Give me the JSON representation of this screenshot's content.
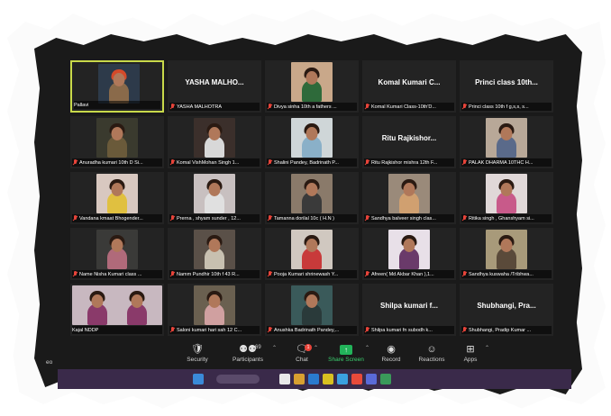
{
  "participants": [
    {
      "caption": "Pallavi",
      "display_name": "",
      "video": true,
      "active": true,
      "muted": false,
      "bg": "#2d3a4a",
      "top": "#8a6a4a",
      "hair": "#d44a2a"
    },
    {
      "caption": "YASHA MALHOTRA",
      "display_name": "YASHA MALHO...",
      "video": false,
      "muted": true
    },
    {
      "caption": "Divya sinha 10th a fathers ...",
      "display_name": "",
      "video": true,
      "muted": true,
      "bg": "#c9a88a",
      "top": "#2e6a3a"
    },
    {
      "caption": "Komal Kumari Class-10th'D...",
      "display_name": "Komal Kumari C...",
      "video": false,
      "muted": true
    },
    {
      "caption": "Princi class 10th f g,s,s, s...",
      "display_name": "Princi class 10th...",
      "video": false,
      "muted": true
    },
    {
      "caption": "Anuradha kumari 10th D Si...",
      "display_name": "",
      "video": true,
      "muted": true,
      "bg": "#3a3a2e",
      "top": "#6a5a3a"
    },
    {
      "caption": "Komal VishMohan Singh 1...",
      "display_name": "",
      "video": true,
      "muted": true,
      "bg": "#3b2f2b",
      "top": "#d8d8d8"
    },
    {
      "caption": "Shalini Pandey, Badrinath P...",
      "display_name": "",
      "video": true,
      "muted": true,
      "bg": "#cfd6d8",
      "top": "#8ab0c8"
    },
    {
      "caption": "Ritu Rajkishor mishra 12th F...",
      "display_name": "Ritu Rajkishor...",
      "video": false,
      "muted": true
    },
    {
      "caption": "PALAK DHARMA 10THC H...",
      "display_name": "",
      "video": true,
      "muted": true,
      "bg": "#b8a898",
      "top": "#5a6a8a"
    },
    {
      "caption": "Vandana kmaat Bhogender...",
      "display_name": "",
      "video": true,
      "muted": true,
      "bg": "#d8c8c0",
      "top": "#e0c040"
    },
    {
      "caption": "Prerna , shyam sunder , 12...",
      "display_name": "",
      "video": true,
      "muted": true,
      "bg": "#c8c0c0",
      "top": "#e0e0e0"
    },
    {
      "caption": "Tamanna dorilal 10c ( H.N )",
      "display_name": "",
      "video": true,
      "muted": true,
      "bg": "#8a7a6a",
      "top": "#3a3a3a"
    },
    {
      "caption": "Sandhya balveer singh clas...",
      "display_name": "",
      "video": true,
      "muted": true,
      "bg": "#9a8a7a",
      "top": "#d0a070"
    },
    {
      "caption": "Ritika singh , Ghanshyam si...",
      "display_name": "",
      "video": true,
      "muted": true,
      "bg": "#e0d8d8",
      "top": "#c85a8a"
    },
    {
      "caption": "Name Nisha Kumari class ...",
      "display_name": "",
      "video": true,
      "muted": true,
      "bg": "#3a3a38",
      "top": "#b06a7a"
    },
    {
      "caption": "Namm Pundhir 10th f 43 R...",
      "display_name": "",
      "video": true,
      "muted": true,
      "bg": "#5a5048",
      "top": "#c8c0b0"
    },
    {
      "caption": "Pooja Kumari shrinewash Y...",
      "display_name": "",
      "video": true,
      "muted": true,
      "bg": "#d0c8c0",
      "top": "#c83a3a"
    },
    {
      "caption": "Afreen( Md Akbar Khan ),1...",
      "display_name": "",
      "video": true,
      "muted": true,
      "bg": "#e8e0e8",
      "top": "#6a3a6a"
    },
    {
      "caption": "Sandhya kuswaha /Tribhwa...",
      "display_name": "",
      "video": true,
      "muted": true,
      "bg": "#a89a7a",
      "top": "#5a4a3a"
    },
    {
      "caption": "Kajal NDDP",
      "display_name": "",
      "video": true,
      "wide": true,
      "muted": false,
      "bg": "#c8b8c0",
      "top": "#8a3a6a"
    },
    {
      "caption": "Saloni kumari hari sah 12 C...",
      "display_name": "",
      "video": true,
      "muted": true,
      "bg": "#6a6050",
      "top": "#d0a0a0"
    },
    {
      "caption": "Anushka Badrinath Pandey,...",
      "display_name": "",
      "video": true,
      "muted": true,
      "bg": "#3a5a5a",
      "top": "#2a3a3a"
    },
    {
      "caption": "Shilpa kumari fn subodh k...",
      "display_name": "Shilpa kumari f...",
      "video": false,
      "muted": true
    },
    {
      "caption": "Shubhangi, Pradip Kumar ...",
      "display_name": "Shubhangi, Pra...",
      "video": false,
      "muted": true
    }
  ],
  "toolbar": {
    "edge_label": "eo",
    "security": "Security",
    "participants": "Participants",
    "participants_count": "69",
    "chat": "Chat",
    "chat_badge": "1",
    "share_screen": "Share Screen",
    "record": "Record",
    "reactions": "Reactions",
    "apps": "Apps"
  },
  "icons": {
    "security": "shield-icon",
    "participants": "people-icon",
    "chat": "chat-bubble-icon",
    "share": "share-arrow-icon",
    "record": "record-icon",
    "reactions": "smiley-icon",
    "apps": "apps-grid-icon",
    "mic": "mic-off-icon"
  },
  "colors": {
    "active_speaker_border": "#c8d94a",
    "share_green": "#22b35a",
    "muted_red": "#e8443a",
    "taskbar": "#3a2a4a"
  },
  "taskbar_icons": [
    "#3a8ad8",
    "#e8e8e8",
    "#d8a030",
    "#2a7ad0",
    "#d8c020",
    "#3aa0e0",
    "#e84a3a",
    "#5a6ad8",
    "#3a9a5a"
  ]
}
